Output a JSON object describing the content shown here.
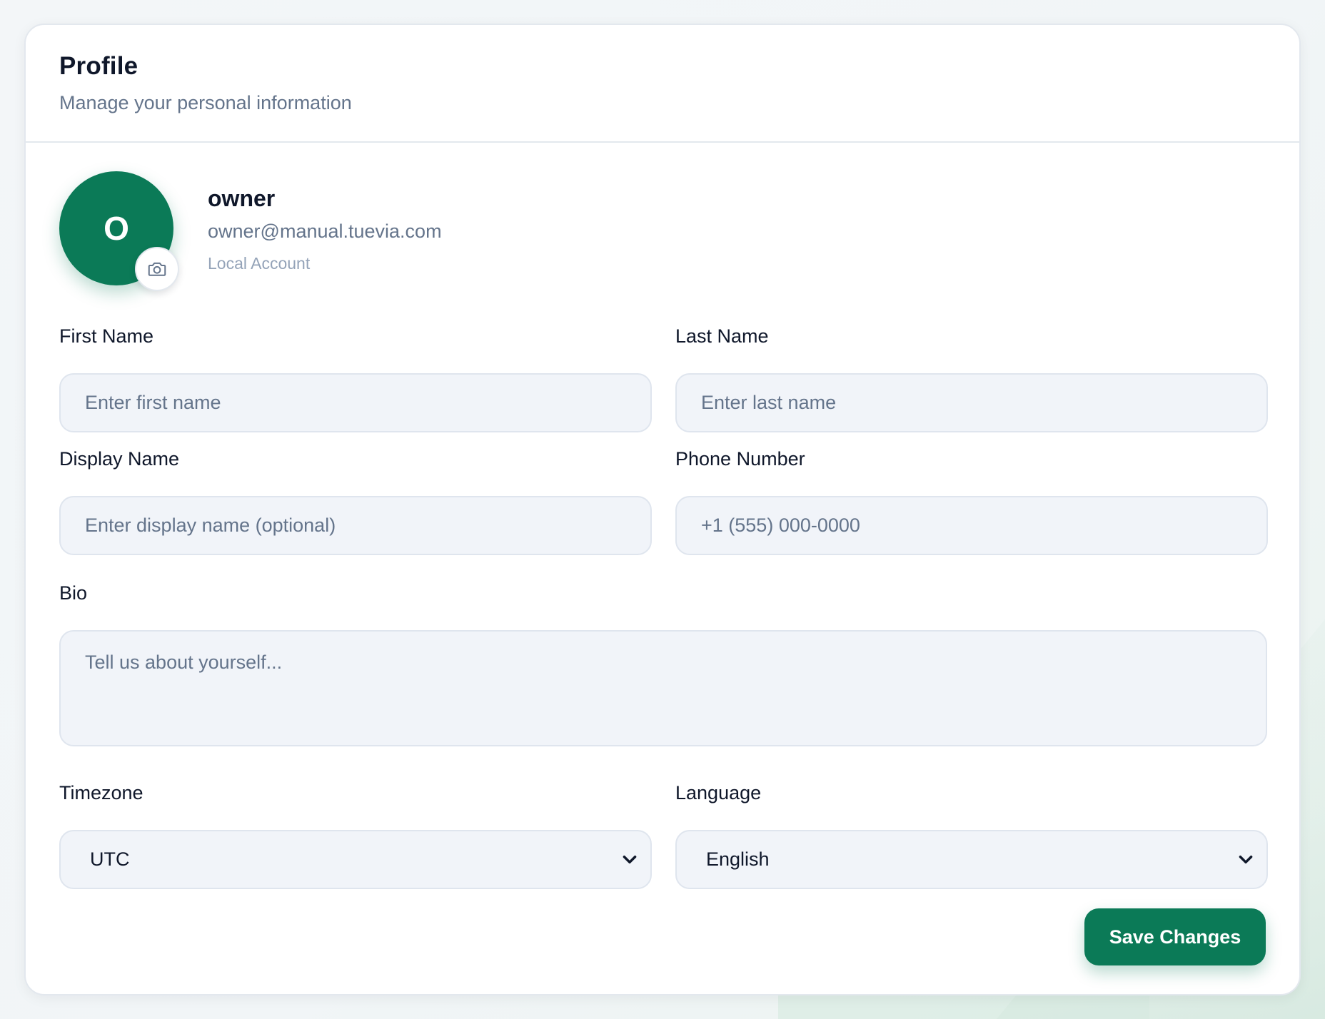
{
  "profile_card": {
    "title": "Profile",
    "subtitle": "Manage your personal information"
  },
  "user": {
    "avatar_initial": "O",
    "avatar_color": "#0b7a57",
    "name": "owner",
    "email": "owner@manual.tuevia.com",
    "account_type": "Local Account",
    "camera_icon": "camera-icon"
  },
  "form": {
    "first_name": {
      "label": "First Name",
      "placeholder": "Enter first name",
      "value": ""
    },
    "last_name": {
      "label": "Last Name",
      "placeholder": "Enter last name",
      "value": ""
    },
    "display_name": {
      "label": "Display Name",
      "placeholder": "Enter display name (optional)",
      "value": ""
    },
    "phone_number": {
      "label": "Phone Number",
      "placeholder": "+1 (555) 000-0000",
      "value": ""
    },
    "bio": {
      "label": "Bio",
      "placeholder": "Tell us about yourself...",
      "value": ""
    },
    "timezone": {
      "label": "Timezone",
      "selected": "UTC",
      "icon": "chevron-down-icon"
    },
    "language": {
      "label": "Language",
      "selected": "English",
      "icon": "chevron-down-icon"
    }
  },
  "actions": {
    "save_label": "Save Changes"
  },
  "colors": {
    "accent": "#0b7a57",
    "input_bg": "#f1f4f9",
    "muted_text": "#64748b"
  }
}
